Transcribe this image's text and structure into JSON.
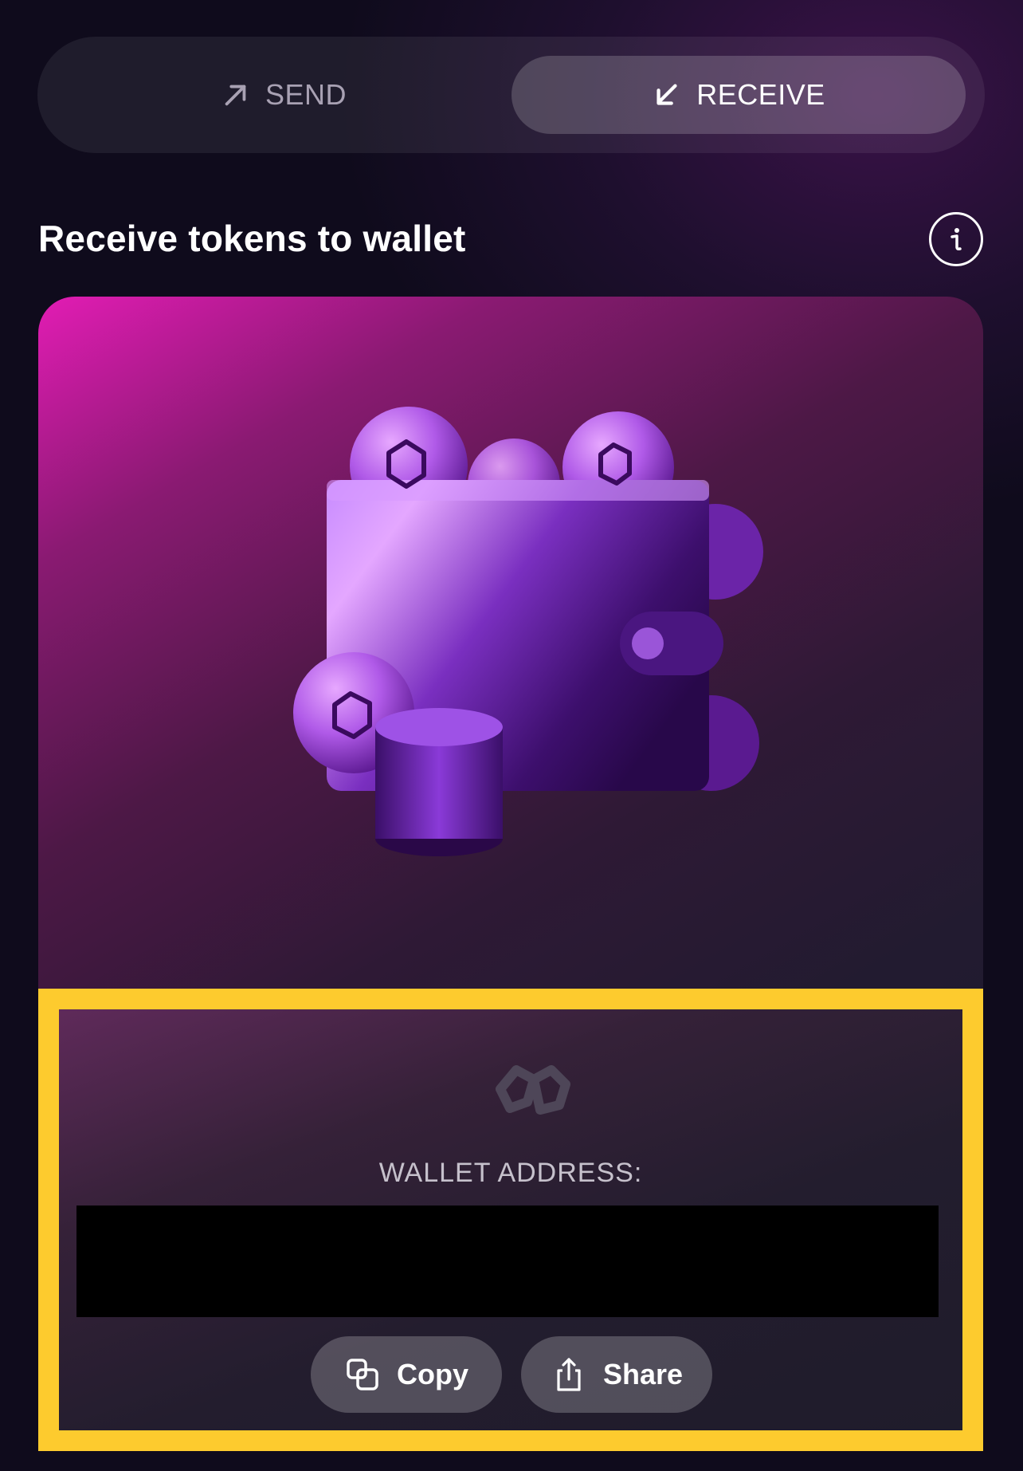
{
  "tabs": {
    "send_label": "SEND",
    "receive_label": "RECEIVE",
    "active": "RECEIVE"
  },
  "header": {
    "title": "Receive tokens to wallet"
  },
  "address": {
    "label": "WALLET ADDRESS:",
    "value": ""
  },
  "actions": {
    "copy_label": "Copy",
    "share_label": "Share"
  },
  "icons": {
    "send": "arrow-up-right-icon",
    "receive": "arrow-down-left-icon",
    "info": "info-icon",
    "copy": "copy-icon",
    "share": "share-icon",
    "brand": "brand-logo-icon"
  },
  "colors": {
    "highlight_border": "#fdcb2e",
    "accent_pink": "#e21cb4",
    "background": "#0f0b1c"
  }
}
